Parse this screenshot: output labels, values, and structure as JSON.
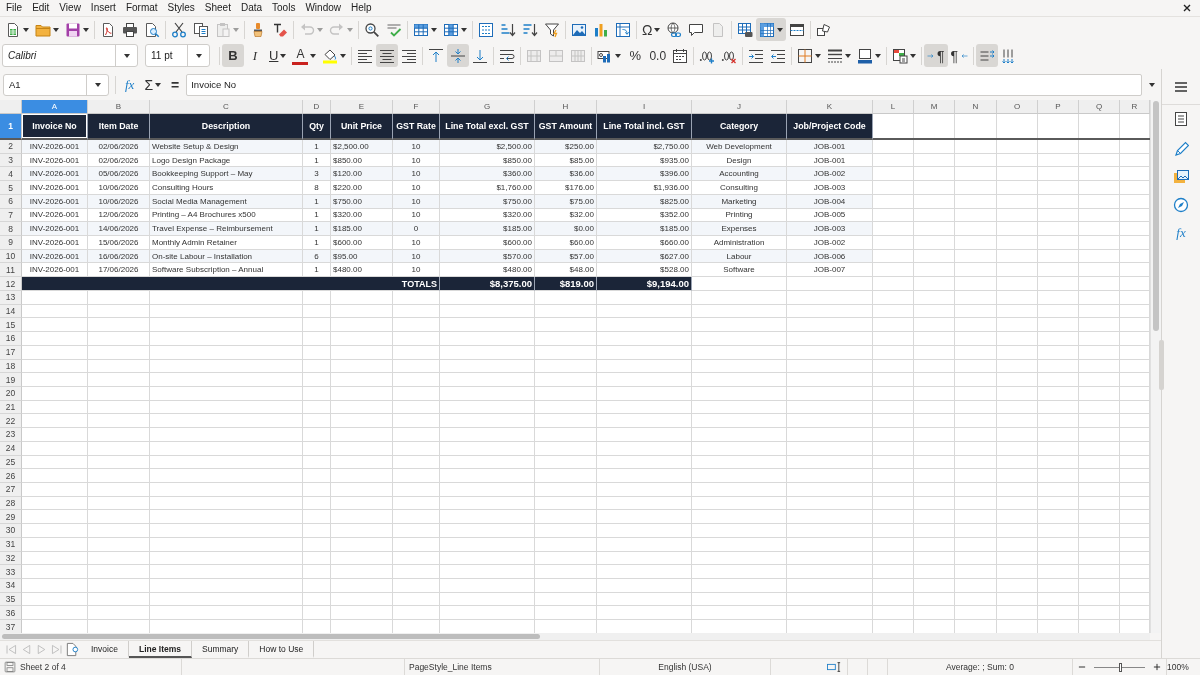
{
  "menu": [
    "File",
    "Edit",
    "View",
    "Insert",
    "Format",
    "Styles",
    "Sheet",
    "Data",
    "Tools",
    "Window",
    "Help"
  ],
  "standard_toolbar": {
    "paste": {
      "disabled": true
    },
    "undo": {
      "disabled": true
    },
    "redo": {
      "disabled": true
    },
    "headers_footers": {
      "disabled": true
    },
    "freeze_rows_and_columns": {
      "on": true
    },
    "special_character": {
      "label": "Ω"
    }
  },
  "formatting_toolbar": {
    "font_name": "Calibri",
    "font_size": "11 pt",
    "bold": {
      "label": "B",
      "on": true
    },
    "italic": {
      "label": "I",
      "on": false
    },
    "underline": {
      "label": "U",
      "on": false
    },
    "font_color": {
      "label": "A"
    },
    "align_left": {
      "on": false
    },
    "align_center": {
      "on": true
    },
    "align_right": {
      "on": false
    },
    "align_top": {
      "on": false
    },
    "center_vertically": {
      "on": true
    },
    "align_bottom": {
      "on": false
    },
    "merge_and_center": {
      "disabled": true
    },
    "merge_cells": {
      "disabled": true
    },
    "unmerge_cells": {
      "disabled": true
    },
    "percent": {
      "label": "%"
    },
    "number": {
      "label": "0.0"
    },
    "left_to_right": {
      "label": "¶",
      "on": true
    },
    "right_to_left": {
      "label": "¶",
      "on": false
    },
    "text_horizontal": {
      "on": true
    },
    "text_vertical": {
      "on": false
    }
  },
  "formula_bar": {
    "name_box": "A1",
    "function_wizard": "fx",
    "sum": "Σ",
    "equals": "=",
    "formula": "Invoice No"
  },
  "sidebar": {
    "functions_label": "fx"
  },
  "sheet": {
    "column_headers": [
      {
        "label": "A",
        "selected": true
      },
      {
        "label": "B",
        "selected": false
      },
      {
        "label": "C",
        "selected": false
      },
      {
        "label": "D",
        "selected": false
      },
      {
        "label": "E",
        "selected": false
      },
      {
        "label": "F",
        "selected": false
      },
      {
        "label": "G",
        "selected": false
      },
      {
        "label": "H",
        "selected": false
      },
      {
        "label": "I",
        "selected": false
      },
      {
        "label": "J",
        "selected": false
      },
      {
        "label": "K",
        "selected": false
      },
      {
        "label": "L",
        "selected": false
      },
      {
        "label": "M",
        "selected": false
      },
      {
        "label": "N",
        "selected": false
      },
      {
        "label": "O",
        "selected": false
      },
      {
        "label": "P",
        "selected": false
      },
      {
        "label": "Q",
        "selected": false
      },
      {
        "label": "R",
        "selected": false
      }
    ],
    "row_headers": [
      {
        "label": "1",
        "selected": true
      },
      {
        "label": "2",
        "selected": false
      },
      {
        "label": "3",
        "selected": false
      },
      {
        "label": "4",
        "selected": false
      },
      {
        "label": "5",
        "selected": false
      },
      {
        "label": "6",
        "selected": false
      },
      {
        "label": "7",
        "selected": false
      },
      {
        "label": "8",
        "selected": false
      },
      {
        "label": "9",
        "selected": false
      },
      {
        "label": "10",
        "selected": false
      },
      {
        "label": "11",
        "selected": false
      },
      {
        "label": "12",
        "selected": false
      },
      {
        "label": "13",
        "selected": false
      },
      {
        "label": "14",
        "selected": false
      },
      {
        "label": "15",
        "selected": false
      },
      {
        "label": "16",
        "selected": false
      },
      {
        "label": "17",
        "selected": false
      },
      {
        "label": "18",
        "selected": false
      },
      {
        "label": "19",
        "selected": false
      },
      {
        "label": "20",
        "selected": false
      },
      {
        "label": "21",
        "selected": false
      },
      {
        "label": "22",
        "selected": false
      },
      {
        "label": "23",
        "selected": false
      },
      {
        "label": "24",
        "selected": false
      },
      {
        "label": "25",
        "selected": false
      },
      {
        "label": "26",
        "selected": false
      },
      {
        "label": "27",
        "selected": false
      },
      {
        "label": "28",
        "selected": false
      },
      {
        "label": "29",
        "selected": false
      },
      {
        "label": "30",
        "selected": false
      },
      {
        "label": "31",
        "selected": false
      },
      {
        "label": "32",
        "selected": false
      },
      {
        "label": "33",
        "selected": false
      },
      {
        "label": "34",
        "selected": false
      },
      {
        "label": "35",
        "selected": false
      },
      {
        "label": "36",
        "selected": false
      },
      {
        "label": "37",
        "selected": false
      }
    ],
    "header_row": [
      "Invoice No",
      "Item Date",
      "Description",
      "Qty",
      "Unit Price",
      "GST Rate",
      "Line Total excl. GST",
      "GST Amount",
      "Line Total incl. GST",
      "Category",
      "Job/Project Code"
    ],
    "rows": [
      [
        "INV-2026-001",
        "02/06/2026",
        "Website Setup & Design",
        "1",
        "$2,500.00",
        "10",
        "$2,500.00",
        "$250.00",
        "$2,750.00",
        "Web Development",
        "JOB-001"
      ],
      [
        "INV-2026-001",
        "02/06/2026",
        "Logo Design Package",
        "1",
        "$850.00",
        "10",
        "$850.00",
        "$85.00",
        "$935.00",
        "Design",
        "JOB-001"
      ],
      [
        "INV-2026-001",
        "05/06/2026",
        "Bookkeeping Support – May",
        "3",
        "$120.00",
        "10",
        "$360.00",
        "$36.00",
        "$396.00",
        "Accounting",
        "JOB-002"
      ],
      [
        "INV-2026-001",
        "10/06/2026",
        "Consulting Hours",
        "8",
        "$220.00",
        "10",
        "$1,760.00",
        "$176.00",
        "$1,936.00",
        "Consulting",
        "JOB-003"
      ],
      [
        "INV-2026-001",
        "10/06/2026",
        "Social Media Management",
        "1",
        "$750.00",
        "10",
        "$750.00",
        "$75.00",
        "$825.00",
        "Marketing",
        "JOB-004"
      ],
      [
        "INV-2026-001",
        "12/06/2026",
        "Printing – A4 Brochures x500",
        "1",
        "$320.00",
        "10",
        "$320.00",
        "$32.00",
        "$352.00",
        "Printing",
        "JOB-005"
      ],
      [
        "INV-2026-001",
        "14/06/2026",
        "Travel Expense – Reimbursement",
        "1",
        "$185.00",
        "0",
        "$185.00",
        "$0.00",
        "$185.00",
        "Expenses",
        "JOB-003"
      ],
      [
        "INV-2026-001",
        "15/06/2026",
        "Monthly Admin Retainer",
        "1",
        "$600.00",
        "10",
        "$600.00",
        "$60.00",
        "$660.00",
        "Administration",
        "JOB-002"
      ],
      [
        "INV-2026-001",
        "16/06/2026",
        "On-site Labour – Installation",
        "6",
        "$95.00",
        "10",
        "$570.00",
        "$57.00",
        "$627.00",
        "Labour",
        "JOB-006"
      ],
      [
        "INV-2026-001",
        "17/06/2026",
        "Software Subscription – Annual",
        "1",
        "$480.00",
        "10",
        "$480.00",
        "$48.00",
        "$528.00",
        "Software",
        "JOB-007"
      ]
    ],
    "totals_row": {
      "label": "TOTALS",
      "values": [
        "$8,375.00",
        "$819.00",
        "$9,194.00"
      ]
    }
  },
  "sheet_tabs": [
    {
      "label": "Invoice",
      "selected": false
    },
    {
      "label": "Line Items",
      "selected": true
    },
    {
      "label": "Summary",
      "selected": false
    },
    {
      "label": "How to Use",
      "selected": false
    }
  ],
  "status_bar": {
    "sheet_position": "Sheet 2 of 4",
    "page_style": "PageStyle_Line Items",
    "language": "English (USA)",
    "selection_summary": "Average: ; Sum: 0",
    "zoom": {
      "level": 0.5,
      "reading": "100%"
    }
  }
}
